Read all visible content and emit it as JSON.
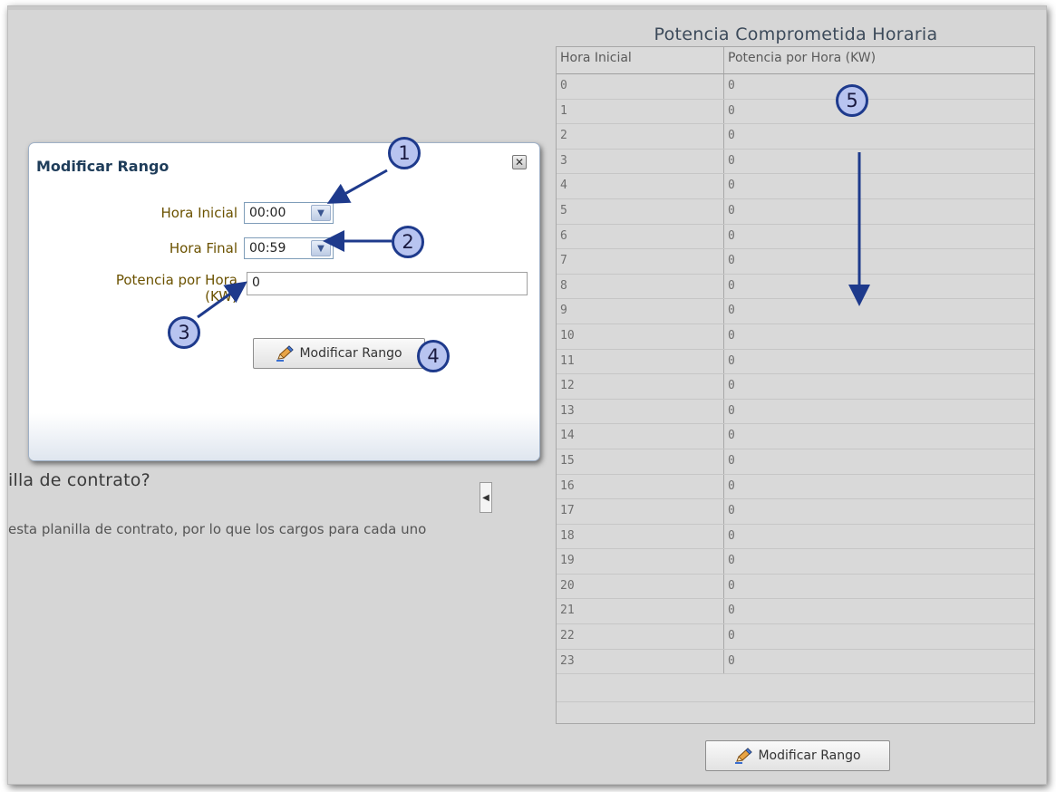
{
  "background": {
    "heading": "illa de contrato?",
    "text": "esta planilla de contrato, por lo que los cargos para cada uno"
  },
  "table": {
    "title": "Potencia Comprometida Horaria",
    "columns": [
      "Hora Inicial",
      "Potencia por Hora (KW)"
    ],
    "rows": [
      [
        "0",
        "0"
      ],
      [
        "1",
        "0"
      ],
      [
        "2",
        "0"
      ],
      [
        "3",
        "0"
      ],
      [
        "4",
        "0"
      ],
      [
        "5",
        "0"
      ],
      [
        "6",
        "0"
      ],
      [
        "7",
        "0"
      ],
      [
        "8",
        "0"
      ],
      [
        "9",
        "0"
      ],
      [
        "10",
        "0"
      ],
      [
        "11",
        "0"
      ],
      [
        "12",
        "0"
      ],
      [
        "13",
        "0"
      ],
      [
        "14",
        "0"
      ],
      [
        "15",
        "0"
      ],
      [
        "16",
        "0"
      ],
      [
        "17",
        "0"
      ],
      [
        "18",
        "0"
      ],
      [
        "19",
        "0"
      ],
      [
        "20",
        "0"
      ],
      [
        "21",
        "0"
      ],
      [
        "22",
        "0"
      ],
      [
        "23",
        "0"
      ]
    ],
    "button_label": "Modificar Rango"
  },
  "dialog": {
    "title": "Modificar Rango",
    "hora_inicial_label": "Hora Inicial",
    "hora_inicial_value": "00:00",
    "hora_final_label": "Hora Final",
    "hora_final_value": "00:59",
    "potencia_label_line1": "Potencia por Hora",
    "potencia_label_line2": "(KW)",
    "potencia_value": "0",
    "button_label": "Modificar Rango",
    "close_glyph": "✕"
  },
  "callouts": [
    "1",
    "2",
    "3",
    "4",
    "5"
  ],
  "icons": {
    "pencil": "pencil-icon",
    "dropdown": "chevron-down-icon",
    "collapse": "triangle-left-icon"
  },
  "colors": {
    "callout_fill": "#b8c4f0",
    "callout_stroke": "#1e3a8c",
    "label_text": "#6b5200",
    "dialog_title": "#1f3d5a"
  }
}
